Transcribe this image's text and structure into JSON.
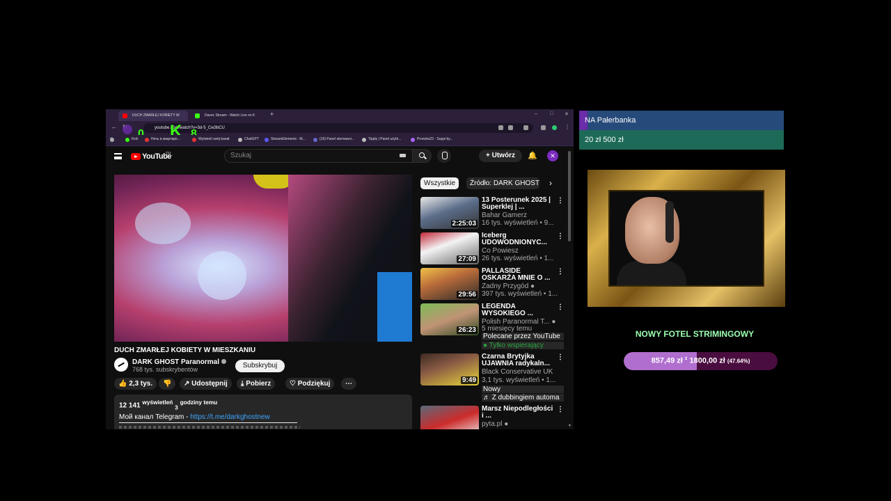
{
  "browser": {
    "tabs": [
      {
        "label": "DUCH ZMARŁEJ KOBIETY W",
        "fav_color": "#ff0000"
      },
      {
        "label": "Davec Stream - Watch Live on K",
        "fav_color": "#39ff14"
      }
    ],
    "new_tab": "+",
    "window_controls": [
      "–",
      "□",
      "✕"
    ],
    "url": "youtube.com/watch?v=3d-5_Cw3bCU",
    "overlay_glyphs": [
      "0",
      "K",
      "8"
    ],
    "bookmarks": [
      {
        "label": "Kick",
        "color": "#39ff14"
      },
      {
        "label": "Ночь в квартире...",
        "color": "#e33"
      },
      {
        "label": "Wyświetl swój kanał",
        "color": "#e33"
      },
      {
        "label": "ChatGPT",
        "color": "#bbb"
      },
      {
        "label": "StreamElements - M...",
        "color": "#5a5aff"
      },
      {
        "label": "(16) Panel sterowani...",
        "color": "#66c"
      },
      {
        "label": "Tipply | Panel użytk...",
        "color": "#bbb"
      },
      {
        "label": "Pronoks22 - Suppi by...",
        "color": "#a6f"
      }
    ]
  },
  "youtube": {
    "logo_text": "YouTube",
    "country_code": "PL",
    "search_placeholder": "Szukaj",
    "create_label": "+ Utwórz",
    "video_title": "DUCH ZMARŁEJ KOBIETY W MIESZKANIU",
    "channel_name": "DARK GHOST Paranormal",
    "channel_subs": "768 tys. subskrybentów",
    "subscribe_label": "Subskrybuj",
    "actions": {
      "like": "👍 2,3 tys.",
      "dislike": "👎",
      "share": "↗ Udostępnij",
      "download": "⤓ Pobierz",
      "thanks": "♡ Podziękuj",
      "more": "⋯"
    },
    "description": {
      "views_count": "12 141",
      "views_label": "wyświetleń",
      "age_count": "3",
      "age_label": "godziny temu",
      "telegram_prefix": "Мой канал Telegram - ",
      "telegram_link": "https://t.me/darkghostnew"
    },
    "chips": {
      "all": "Wszystkie",
      "source": "Źródło: DARK GHOST",
      "next": "›"
    },
    "recommendations": [
      {
        "title": "13 Posterunek 2025 | Superklej | ...",
        "channel": "Bahar Gamerz",
        "meta": "16 tys. wyświetleń • 9...",
        "duration": "2:25:03",
        "thumb": "linear-gradient(160deg,#e8e8e8 0%,#5b6d8a 45%,#333 100%)"
      },
      {
        "title": "Iceberg UDOWODNIONYC...",
        "channel": "Co Powiesz",
        "meta": "26 tys. wyświetleń • 1...",
        "duration": "27:09",
        "thumb": "linear-gradient(160deg,#c0283a 0%,#f3f3f3 40%,#666 100%)"
      },
      {
        "title": "PALLASIDE OSKARŻA MNIE O ...",
        "channel": "Żadny Przygód ●",
        "meta": "397 tys. wyświetleń • 1...",
        "duration": "29:56",
        "thumb": "linear-gradient(160deg,#f0c248 0%,#b96b3a 40%,#2b2b2b 100%)"
      },
      {
        "title": "LEGENDA WYSOKIEGO ...",
        "channel": "Polish Paranormal T... ●",
        "meta": "5 miesięcy temu",
        "badge1": "Polecane przez YouTube",
        "badge2": "● Tylko wspierający",
        "duration": "26:23",
        "thumb": "linear-gradient(160deg,#7dbb55 0%,#c09375 50%,#2d4a22 100%)"
      },
      {
        "title": "Czarna Brytyjka UJAWNIA radykaln...",
        "channel": "Black Conservative UK",
        "meta": "3,1 tys. wyświetleń • 1...",
        "badge1": "Nowy",
        "badge2": "♬ Z dubbingiem automa",
        "duration": "9:49",
        "thumb": "linear-gradient(160deg,#3d2a22 0%,#8a5b44 40%,#e6d43a 100%)"
      },
      {
        "title": "Marsz Niepodległości i ...",
        "channel": "pyta.pl ●",
        "meta": "",
        "duration": "",
        "thumb": "linear-gradient(160deg,#5a6a7a 0%,#cc2b2b 50%,#eee 100%)"
      }
    ]
  },
  "stream": {
    "alert_name": "NA Pałerbanka",
    "alert_amount": "20 zł 500 zł",
    "goal_title": "NOWY FOTEL STRIMINGOWY",
    "goal_current": "857,49 zł",
    "goal_sep": "z",
    "goal_target": "1800,00 zł",
    "goal_percent": "(47.64%)",
    "goal_fraction": 0.4764
  },
  "colors": {
    "youtube_bg": "#0f0f0f",
    "accent_purple": "#6a2ca8",
    "goal_green": "#9dffb0",
    "link_blue": "#3ea6ff"
  }
}
